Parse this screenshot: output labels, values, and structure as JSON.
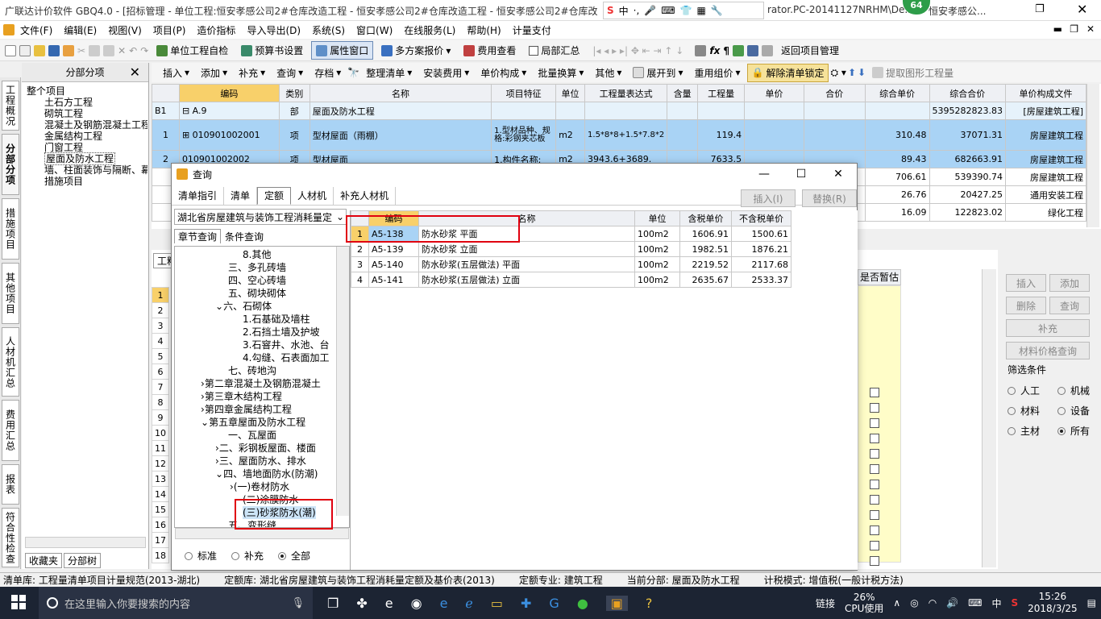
{
  "titlebar": {
    "title": "广联达计价软件 GBQ4.0 - [招标管理 - 单位工程:恒安孝感公司2#仓库改造工程 - 恒安孝感公司2#仓库改造工程 - 恒安孝感公司2#仓库改",
    "right_text": "rator.PC-20141127NRHM\\De...",
    "right_text2": "恒安孝感公...",
    "badge": "64"
  },
  "ime": {
    "lang": "中",
    "symbols": "·,"
  },
  "menu": [
    "文件(F)",
    "编辑(E)",
    "视图(V)",
    "项目(P)",
    "造价指标",
    "导入导出(D)",
    "系统(S)",
    "窗口(W)",
    "在线服务(L)",
    "帮助(H)",
    "计量支付"
  ],
  "toolbar1": {
    "check": "单位工程自检",
    "budget": "预算书设置",
    "attr": "属性窗口",
    "multi": "多方案报价",
    "fee_view": "费用查看",
    "local_sum": "局部汇总",
    "back": "返回项目管理"
  },
  "toolbar2": {
    "insert": "插入",
    "add": "添加",
    "supplement": "补充",
    "query": "查询",
    "save": "存档",
    "organize": "整理清单",
    "install_fee": "安装费用",
    "unit_comp": "单价构成",
    "batch": "批量换算",
    "other": "其他",
    "expand": "展开到",
    "recombine": "重用组价",
    "unlock": "解除清单锁定",
    "extract": "提取图形工程量"
  },
  "lefttabs": [
    "工程概况",
    "分部分项",
    "措施项目",
    "其他项目",
    "人材机汇总",
    "费用汇总",
    "报表",
    "符合性检查"
  ],
  "tree": {
    "header": "分部分项",
    "root": "整个项目",
    "items": [
      "土石方工程",
      "砌筑工程",
      "混凝土及钢筋混凝土工程",
      "金属结构工程",
      "门窗工程",
      "屋面及防水工程",
      "墙、柱面装饰与隔断、幕",
      "措施项目"
    ],
    "bottom_tabs": [
      "收藏夹",
      "分部树"
    ]
  },
  "maingrid": {
    "headers": [
      "编码",
      "类别",
      "名称",
      "项目特征",
      "单位",
      "工程量表达式",
      "含量",
      "工程量",
      "单价",
      "合价",
      "综合单价",
      "综合合价",
      "单价构成文件"
    ],
    "rows": [
      {
        "num": "B1",
        "code": "A.9",
        "type": "部",
        "name": "屋面及防水工程",
        "feature": "",
        "unit": "",
        "expr": "",
        "qty": "",
        "total": "5395282823.83",
        "file": "[房屋建筑工程]"
      },
      {
        "num": "1",
        "code": "010901002001",
        "type": "项",
        "name": "型材屋面（雨棚）",
        "feature": "1.型材品种、规格:彩钢夹芯板",
        "unit": "m2",
        "expr": "1.5*8*8+1.5*7.8*2",
        "qty": "119.4",
        "price": "310.48",
        "total": "37071.31",
        "file": "房屋建筑工程"
      },
      {
        "num": "2",
        "code": "010901002002",
        "type": "项",
        "name": "型材屋面",
        "feature": "1.构件名称:",
        "unit": "m2",
        "expr": "3943.6+3689.",
        "qty": "7633.5",
        "price": "89.43",
        "total": "682663.91",
        "file": "房屋建筑工程"
      },
      {
        "num": "",
        "code": "",
        "type": "",
        "name": "",
        "feature": "",
        "unit": "",
        "expr": "",
        "qty": "",
        "price": "706.61",
        "total": "539390.74",
        "file": "房屋建筑工程"
      },
      {
        "num": "",
        "code": "",
        "type": "",
        "name": "",
        "feature": "",
        "unit": "",
        "expr": "",
        "qty": "",
        "price": "26.76",
        "total": "20427.25",
        "file": "通用安装工程"
      },
      {
        "num": "",
        "code": "",
        "type": "",
        "name": "",
        "feature": "",
        "unit": "",
        "expr": "",
        "qty": "",
        "price": "16.09",
        "total": "122823.02",
        "file": "绿化工程"
      }
    ]
  },
  "lower": {
    "tab": "工料",
    "column": "是否暂估",
    "rows": [
      "1",
      "2",
      "3",
      "4",
      "5",
      "6",
      "7",
      "8",
      "9",
      "10",
      "11",
      "12",
      "13",
      "14",
      "15",
      "16",
      "17",
      "18"
    ]
  },
  "rightpanel": {
    "insert": "插入",
    "add": "添加",
    "delete": "删除",
    "query": "查询",
    "supplement": "补充",
    "price_query": "材料价格查询",
    "filter": "筛选条件",
    "options": [
      "人工",
      "机械",
      "材料",
      "设备",
      "主材",
      "所有"
    ],
    "selected": "所有"
  },
  "dialog": {
    "title": "查询",
    "tabs": [
      "清单指引",
      "清单",
      "定额",
      "人材机",
      "补充人材机"
    ],
    "selected_tab": "定额",
    "insert_btn": "插入(I)",
    "replace_btn": "替换(R)",
    "library": "湖北省房屋建筑与装饰工程消耗量定",
    "subtabs": [
      "章节查询",
      "条件查询"
    ],
    "tree": [
      "8.其他",
      "三、多孔砖墙",
      "四、空心砖墙",
      "五、砌块砌体",
      "六、石砌体",
      "1.石基础及墙柱",
      "2.石挡土墙及护坡",
      "3.石窨井、水池、台",
      "4.勾缝、石表面加工",
      "七、砖地沟",
      "第二章混凝土及钢筋混凝土",
      "第三章木结构工程",
      "第四章金属结构工程",
      "第五章屋面及防水工程",
      "一、瓦屋面",
      "二、彩钢板屋面、楼面",
      "三、屋面防水、排水",
      "四、墙地面防水(防潮)",
      "(一)卷材防水",
      "(二)涂膜防水",
      "(三)砂浆防水(潮)",
      "五、变形缝"
    ],
    "radios": [
      "标准",
      "补充",
      "全部"
    ],
    "radio_selected": "全部",
    "grid_headers": [
      "编码",
      "名称",
      "单位",
      "含税单价",
      "不含税单价"
    ],
    "rows": [
      {
        "n": "1",
        "code": "A5-138",
        "name": "防水砂浆 平面",
        "unit": "100m2",
        "tax": "1606.91",
        "notax": "1500.61"
      },
      {
        "n": "2",
        "code": "A5-139",
        "name": "防水砂浆 立面",
        "unit": "100m2",
        "tax": "1982.51",
        "notax": "1876.21"
      },
      {
        "n": "3",
        "code": "A5-140",
        "name": "防水砂浆(五层做法) 平面",
        "unit": "100m2",
        "tax": "2219.52",
        "notax": "2117.68"
      },
      {
        "n": "4",
        "code": "A5-141",
        "name": "防水砂浆(五层做法) 立面",
        "unit": "100m2",
        "tax": "2635.67",
        "notax": "2533.37"
      }
    ]
  },
  "statusbar": {
    "qd": "清单库: 工程量清单项目计量规范(2013-湖北)",
    "de": "定额库: 湖北省房屋建筑与装饰工程消耗量定额及基价表(2013)",
    "spec": "定额专业: 建筑工程",
    "cur": "当前分部: 屋面及防水工程",
    "mode": "计税模式: 增值税(一般计税方法)"
  },
  "taskbar": {
    "search": "在这里输入你要搜索的内容",
    "link": "链接",
    "cpu": "26%",
    "cpu_label": "CPU使用",
    "lang": "中",
    "time": "15:26",
    "date": "2018/3/25"
  }
}
